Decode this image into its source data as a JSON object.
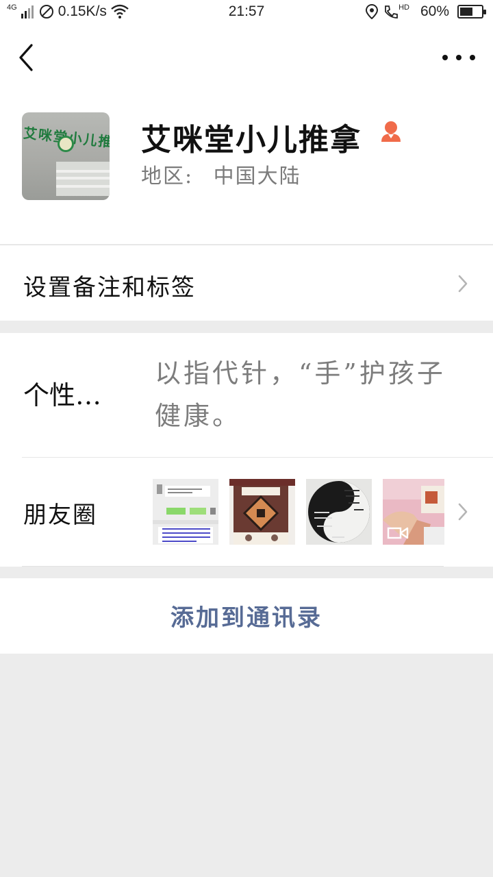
{
  "status_bar": {
    "network": "4G",
    "speed": "0.15K/s",
    "time": "21:57",
    "hd": "HD",
    "battery": "60%",
    "battery_level": 0.6
  },
  "profile": {
    "name": "艾咪堂小儿推拿",
    "region_label": "地区:",
    "region_value": "中国大陆",
    "avatar_sign": "艾咪堂小儿推拿"
  },
  "rows": {
    "remark_label": "设置备注和标签",
    "signature_label": "个性…",
    "signature_value": "以指代针，“手”护孩子健康。",
    "moments_label": "朋友圈"
  },
  "actions": {
    "add_to_contacts": "添加到通讯录"
  },
  "colors": {
    "link_blue": "#576b95",
    "female_icon": "#f06b4a"
  }
}
